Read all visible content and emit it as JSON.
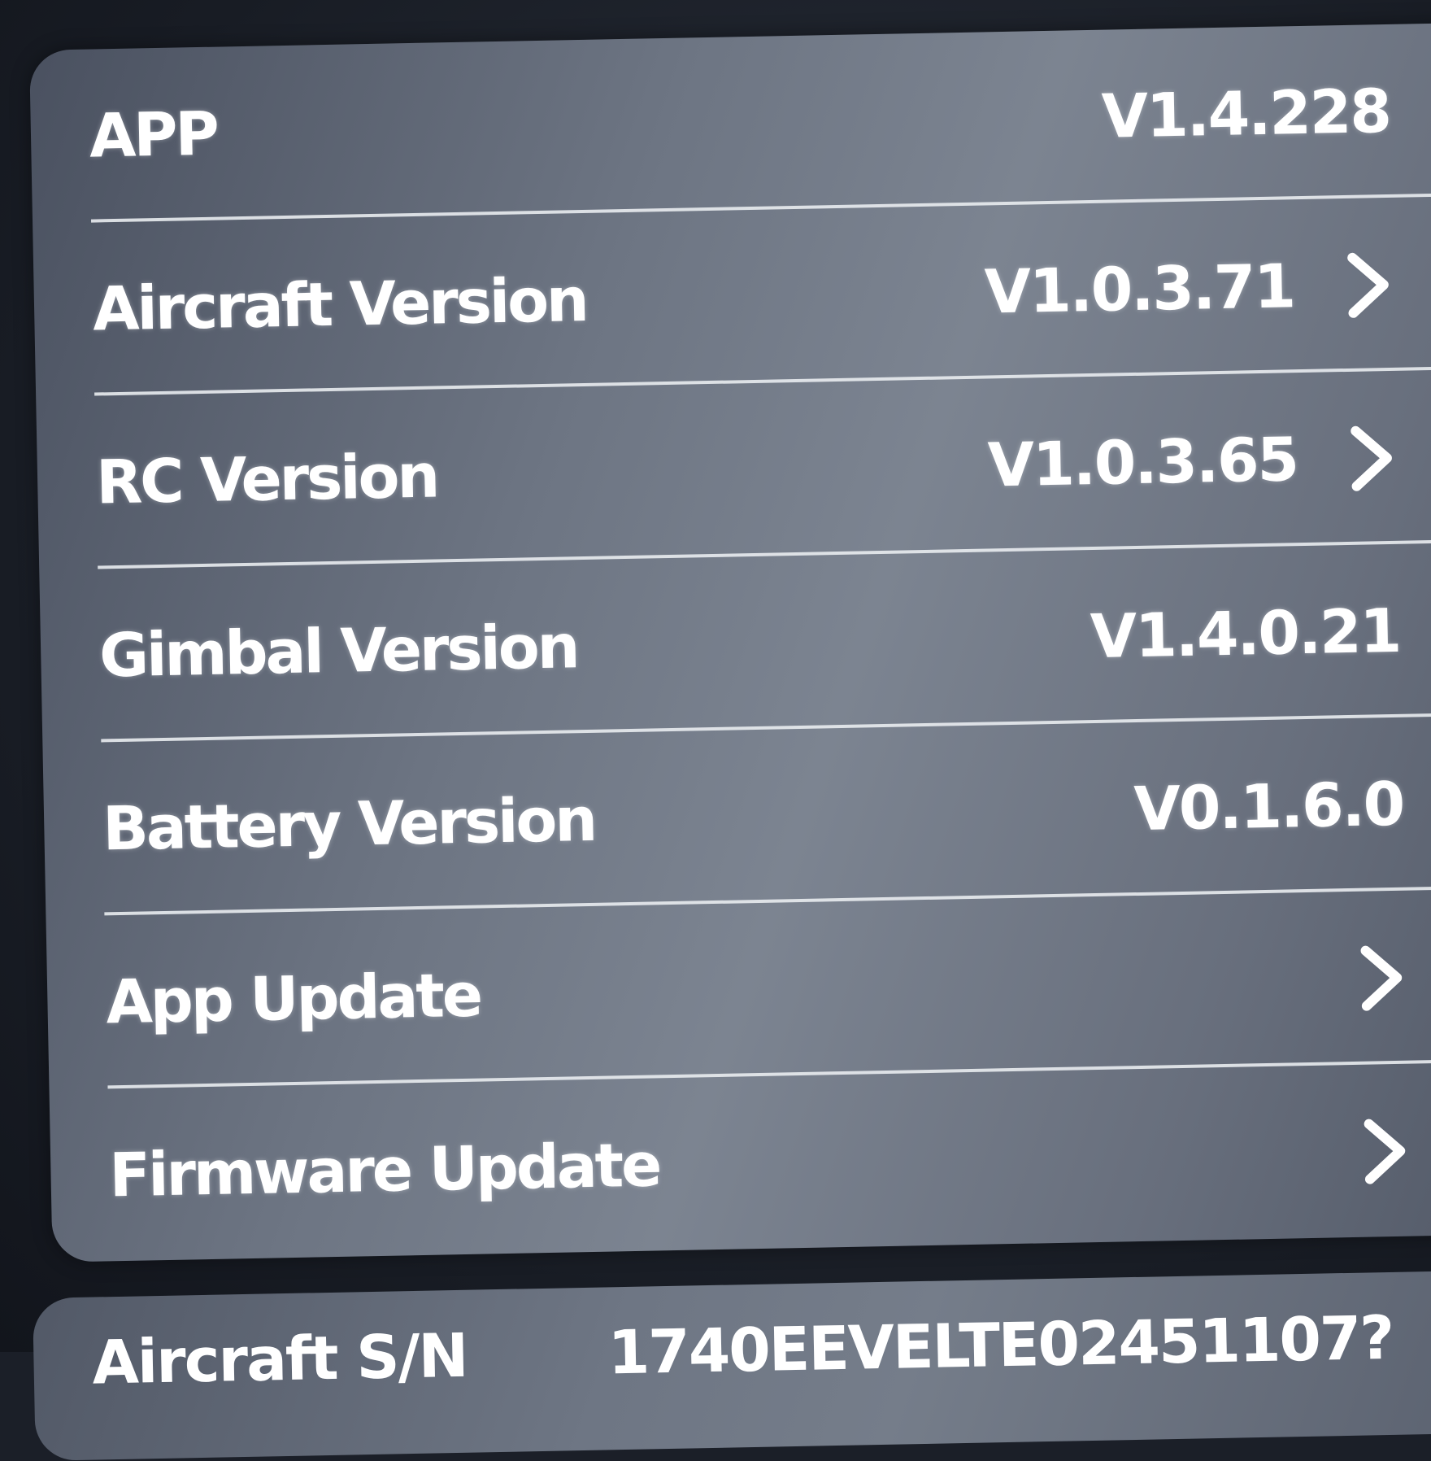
{
  "version_list": {
    "rows": [
      {
        "label": "APP",
        "value": "V1.4.228",
        "has_chevron": false
      },
      {
        "label": "Aircraft Version",
        "value": "V1.0.3.71",
        "has_chevron": true
      },
      {
        "label": "RC Version",
        "value": "V1.0.3.65",
        "has_chevron": true
      },
      {
        "label": "Gimbal Version",
        "value": "V1.4.0.21",
        "has_chevron": false
      },
      {
        "label": "Battery Version",
        "value": "V0.1.6.0",
        "has_chevron": false
      },
      {
        "label": "App Update",
        "value": "",
        "has_chevron": true
      },
      {
        "label": "Firmware Update",
        "value": "",
        "has_chevron": true
      }
    ]
  },
  "serial_panel": {
    "label": "Aircraft S/N",
    "value": "1740EEVELTE02451107?"
  },
  "colors": {
    "text": "#ffffff",
    "divider": "#e9ecef",
    "background": "#181c24"
  },
  "icons": {
    "chevron": "chevron-right-icon"
  }
}
